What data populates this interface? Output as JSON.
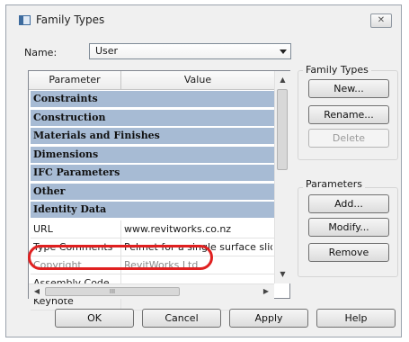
{
  "window": {
    "title": "Family Types",
    "close_glyph": "✕"
  },
  "name_field": {
    "label": "Name:",
    "value": "User"
  },
  "grid": {
    "headers": {
      "parameter": "Parameter",
      "value": "Value"
    },
    "groups": [
      "Constraints",
      "Construction",
      "Materials and Finishes",
      "Dimensions",
      "IFC Parameters",
      "Other",
      "Identity Data"
    ],
    "rows": [
      {
        "parameter": "URL",
        "value": "www.revitworks.co.nz"
      },
      {
        "parameter": "Type Comments",
        "value": "Pelmet for a single surface slider"
      },
      {
        "parameter": "Copyright",
        "value": "RevitWorks Ltd"
      },
      {
        "parameter": "Assembly Code",
        "value": ""
      },
      {
        "parameter": "Keynote",
        "value": ""
      }
    ],
    "hscroll_glyph": "III"
  },
  "family_types_group": {
    "title": "Family Types",
    "new_label": "New...",
    "rename_label": "Rename...",
    "delete_label": "Delete"
  },
  "parameters_group": {
    "title": "Parameters",
    "add_label": "Add...",
    "modify_label": "Modify...",
    "remove_label": "Remove"
  },
  "footer": {
    "ok_label": "OK",
    "cancel_label": "Cancel",
    "apply_label": "Apply",
    "help_label": "Help"
  },
  "colors": {
    "group_row": "#a7bbd4",
    "highlight_ring": "#e02020"
  }
}
